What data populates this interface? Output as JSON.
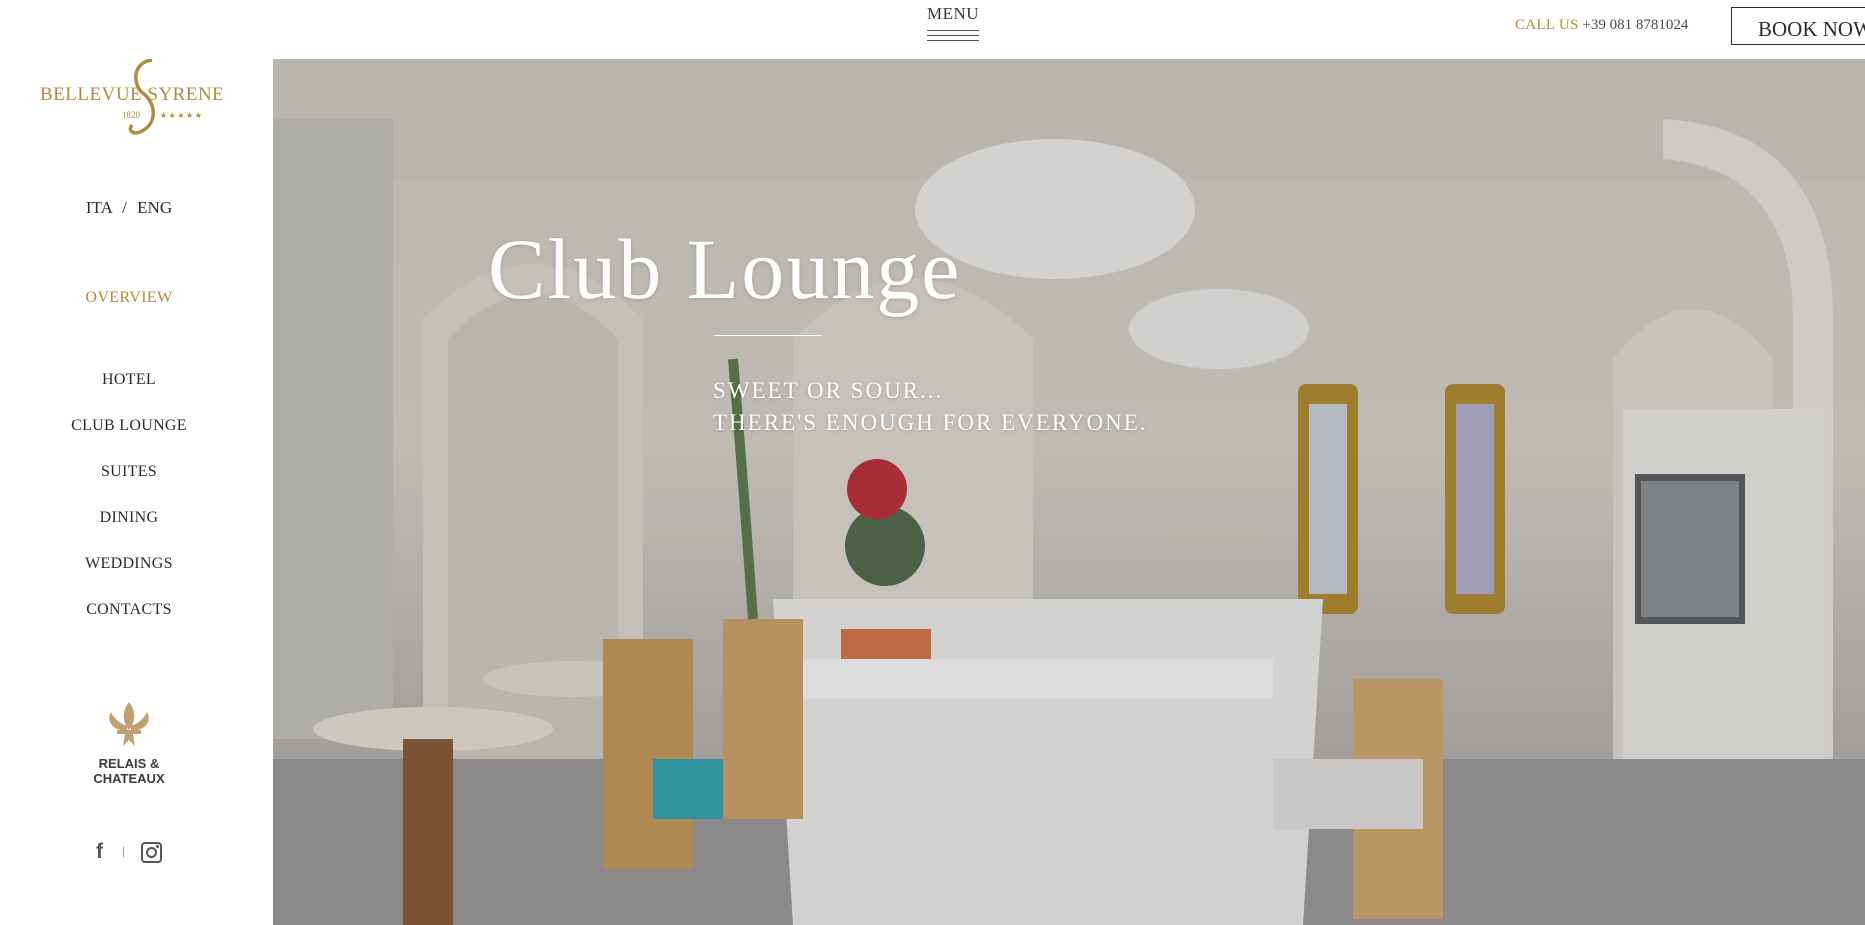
{
  "brand": {
    "logo_text": "BELLEVUE SYRENE",
    "logo_year": "1820",
    "logo_stars": "★★★★★"
  },
  "topbar": {
    "menu_label": "MENU",
    "call_label": "CALL US",
    "call_number": "+39 081 8781024",
    "book_label": "BOOK NOW"
  },
  "sidebar": {
    "lang_ita": "ITA",
    "lang_sep": "/",
    "lang_eng": "ENG",
    "overview": "OVERVIEW",
    "nav": [
      {
        "label": "HOTEL"
      },
      {
        "label": "CLUB LOUNGE"
      },
      {
        "label": "SUITES"
      },
      {
        "label": "DINING"
      },
      {
        "label": "WEDDINGS"
      },
      {
        "label": "CONTACTS"
      }
    ],
    "relais_line1": "RELAIS &",
    "relais_line2": "CHATEAUX",
    "social_sep": "|"
  },
  "hero": {
    "title": "Club Lounge",
    "tagline_line1": "SWEET OR SOUR...",
    "tagline_line2": "THERE'S ENOUGH FOR EVERYONE."
  },
  "colors": {
    "accent_gold": "#b08a3e",
    "text_dark": "#2b2b2b"
  }
}
